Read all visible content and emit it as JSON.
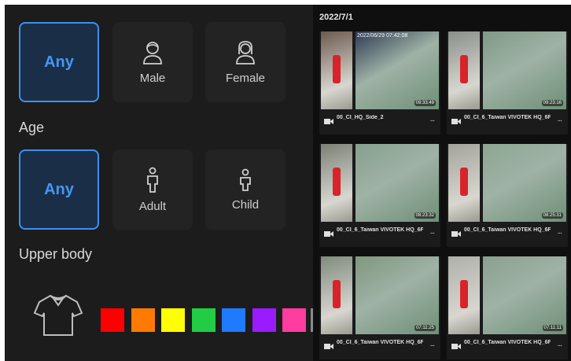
{
  "gender": {
    "options": [
      {
        "label": "Any",
        "selected": true,
        "icon": ""
      },
      {
        "label": "Male",
        "selected": false,
        "icon": "male-person-icon"
      },
      {
        "label": "Female",
        "selected": false,
        "icon": "female-person-icon"
      }
    ]
  },
  "age": {
    "label": "Age",
    "options": [
      {
        "label": "Any",
        "selected": true,
        "icon": ""
      },
      {
        "label": "Adult",
        "selected": false,
        "icon": "adult-icon"
      },
      {
        "label": "Child",
        "selected": false,
        "icon": "child-icon"
      }
    ]
  },
  "upper_body": {
    "label": "Upper body",
    "icon": "shirt-icon",
    "colors": [
      "#ff0000",
      "#ff7a00",
      "#ffff00",
      "#22cc44",
      "#1e7bff",
      "#9b1bff",
      "#ff3ca0"
    ]
  },
  "results": {
    "date": "2022/7/1",
    "cards": [
      {
        "caption": "00_CI_HQ_Side_2",
        "osd": "2022/06/29 07:42:08",
        "timestamp": "09:33:49"
      },
      {
        "caption": "00_CI_6_Taiwan VIVOTEK HQ_6F",
        "osd": "",
        "timestamp": "09:23:16"
      },
      {
        "caption": "00_CI_6_Taiwan VIVOTEK HQ_6F",
        "osd": "",
        "timestamp": "08:23:32"
      },
      {
        "caption": "00_CI_6_Taiwan VIVOTEK HQ_6F",
        "osd": "",
        "timestamp": "08:25:31"
      },
      {
        "caption": "00_CI_6_Taiwan VIVOTEK HQ_6F",
        "osd": "",
        "timestamp": "07:11:25"
      },
      {
        "caption": "00_CI_6_Taiwan VIVOTEK HQ_6F",
        "osd": "",
        "timestamp": "07:11:11"
      }
    ],
    "more_label": "..."
  }
}
